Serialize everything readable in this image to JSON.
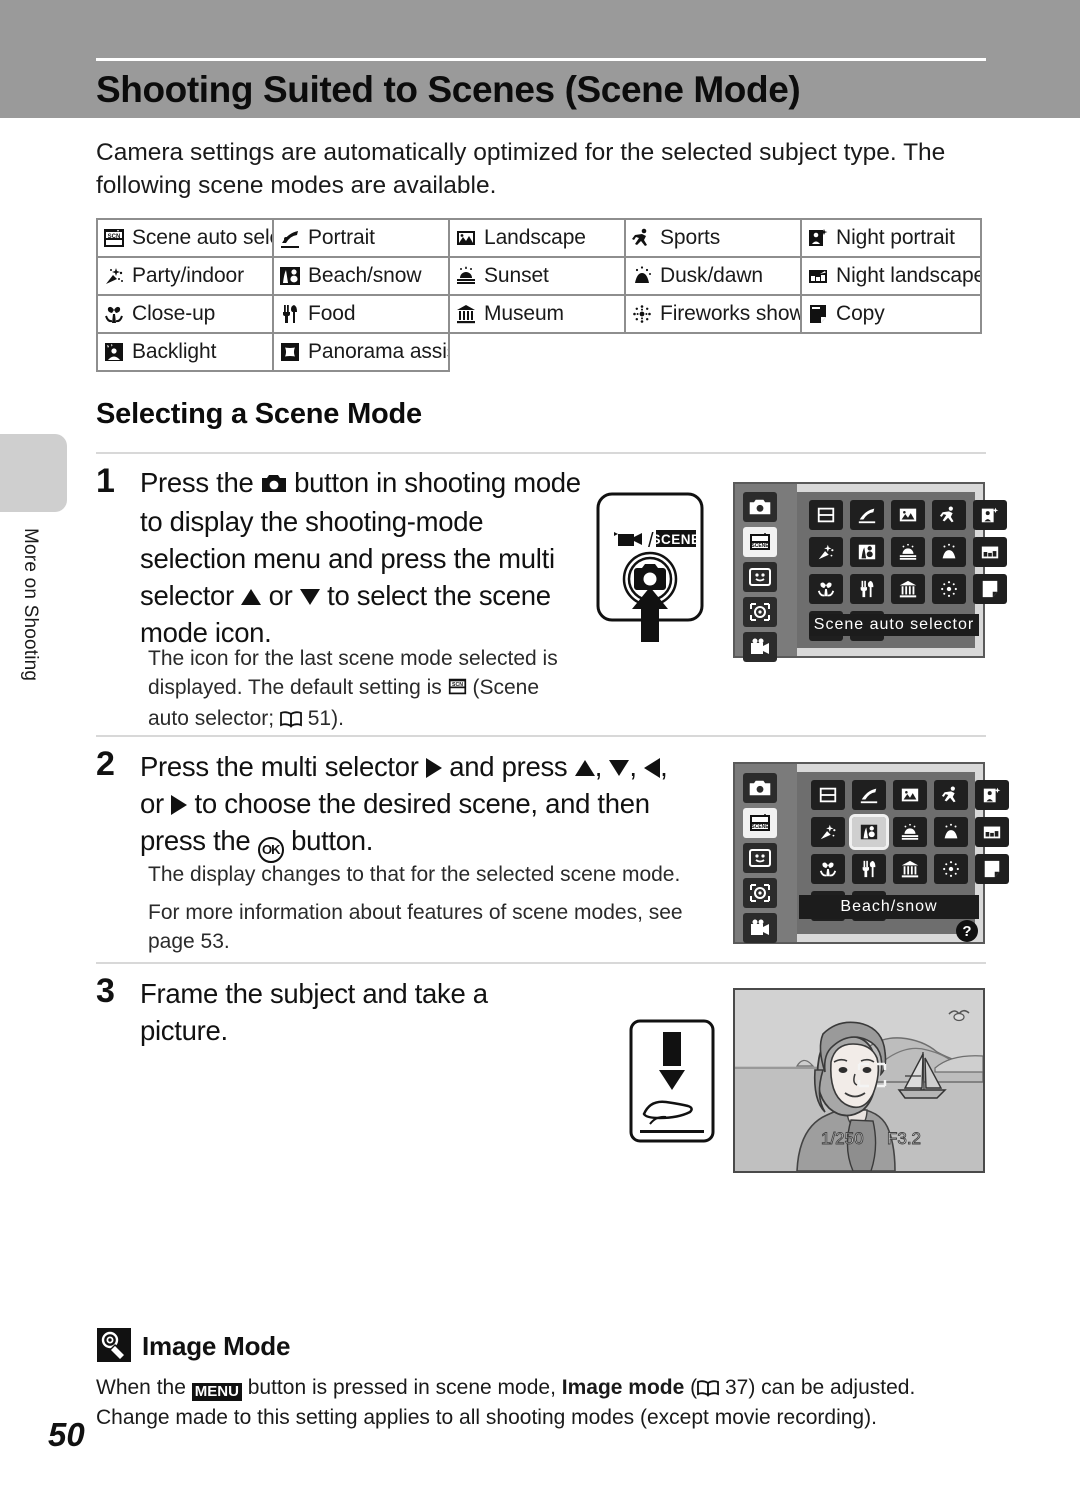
{
  "header": {
    "title": "Shooting Suited to Scenes (Scene Mode)",
    "bar_color": "#9a9a9a"
  },
  "side_tab": {
    "label": "More on Shooting"
  },
  "intro": "Camera settings are automatically optimized for the selected subject type. The following scene modes are available.",
  "scene_table": {
    "rows": [
      [
        {
          "icon": "scene-auto-selector-icon",
          "label": "Scene auto selector"
        },
        {
          "icon": "portrait-icon",
          "label": "Portrait"
        },
        {
          "icon": "landscape-icon",
          "label": "Landscape"
        },
        {
          "icon": "sports-icon",
          "label": "Sports"
        },
        {
          "icon": "night-portrait-icon",
          "label": "Night portrait"
        }
      ],
      [
        {
          "icon": "party-indoor-icon",
          "label": "Party/indoor"
        },
        {
          "icon": "beach-snow-icon",
          "label": "Beach/snow"
        },
        {
          "icon": "sunset-icon",
          "label": "Sunset"
        },
        {
          "icon": "dusk-dawn-icon",
          "label": "Dusk/dawn"
        },
        {
          "icon": "night-landscape-icon",
          "label": "Night landscape"
        }
      ],
      [
        {
          "icon": "close-up-icon",
          "label": "Close-up"
        },
        {
          "icon": "food-icon",
          "label": "Food"
        },
        {
          "icon": "museum-icon",
          "label": "Museum"
        },
        {
          "icon": "fireworks-show-icon",
          "label": "Fireworks show"
        },
        {
          "icon": "copy-icon",
          "label": "Copy"
        }
      ],
      [
        {
          "icon": "backlight-icon",
          "label": "Backlight"
        },
        {
          "icon": "panorama-assist-icon",
          "label": "Panorama assist"
        }
      ]
    ]
  },
  "section": {
    "heading": "Selecting a Scene Mode"
  },
  "steps": [
    {
      "number": "1",
      "main_parts": {
        "a": "Press the ",
        "b": " button in shooting mode to display the shooting-mode selection menu and press the multi selector ",
        "c": " or ",
        "d": " to select the scene mode icon."
      },
      "sub_parts": {
        "a": "The icon for the last scene mode selected is displayed. The default setting is ",
        "b": " (Scene auto selector; ",
        "c": " 51)."
      }
    },
    {
      "number": "2",
      "main_parts": {
        "a": "Press the multi selector ",
        "b": " and press ",
        "c": ", ",
        "d": ", ",
        "e": ", or ",
        "f": " to choose the desired scene, and then press the ",
        "g": " button."
      },
      "sub_1": "The display changes to that for the selected scene mode.",
      "sub_2": "For more information about features of scene modes, see page 53."
    },
    {
      "number": "3",
      "main": "Frame the subject and take a picture."
    }
  ],
  "button_illustration": {
    "label_movie": "movie-mode-icon",
    "label_divider": "/",
    "label_scene": "SCENE",
    "button": "shooting-mode-button",
    "arrow": "press-arrow-up"
  },
  "lcd_screen_1": {
    "mode_icons": [
      "auto-mode-icon",
      "scene-mode-icon",
      "smile-mode-icon",
      "subject-tracking-icon",
      "movie-mode-icon"
    ],
    "selected_mode_index": 1,
    "grid_icons": [
      "scene-auto-selector-icon",
      "portrait-icon",
      "landscape-icon",
      "sports-icon",
      "night-portrait-icon",
      "party-indoor-icon",
      "beach-snow-icon",
      "sunset-icon",
      "dusk-dawn-icon",
      "night-landscape-icon",
      "close-up-icon",
      "food-icon",
      "museum-icon",
      "fireworks-show-icon",
      "copy-icon",
      "backlight-icon",
      "panorama-assist-icon"
    ],
    "highlighted_index": -1,
    "caption": "Scene auto selector",
    "help_badge": null
  },
  "lcd_screen_2": {
    "mode_icons": [
      "auto-mode-icon",
      "scene-mode-icon",
      "smile-mode-icon",
      "subject-tracking-icon",
      "movie-mode-icon"
    ],
    "selected_mode_index": 1,
    "grid_icons": [
      "scene-auto-selector-icon",
      "portrait-icon",
      "landscape-icon",
      "sports-icon",
      "night-portrait-icon",
      "party-indoor-icon",
      "beach-snow-icon",
      "sunset-icon",
      "dusk-dawn-icon",
      "night-landscape-icon",
      "close-up-icon",
      "food-icon",
      "museum-icon",
      "fireworks-show-icon",
      "copy-icon",
      "backlight-icon",
      "panorama-assist-icon"
    ],
    "highlighted_index": 6,
    "caption": "Beach/snow",
    "help_badge": "?"
  },
  "photo_illustration": {
    "shutter_speed": "1/250",
    "aperture": "F3.2",
    "subject": "woman-on-beach-with-sailboat"
  },
  "note": {
    "icon": "image-mode-note-icon",
    "title": "Image Mode",
    "parts": {
      "a": "When the ",
      "b": "MENU",
      "c": " button is pressed in scene mode, ",
      "d": "Image mode",
      "e": " (",
      "f": " 37) can be adjusted. Change made to this setting applies to all shooting modes (except movie recording)."
    }
  },
  "page_number": "50"
}
